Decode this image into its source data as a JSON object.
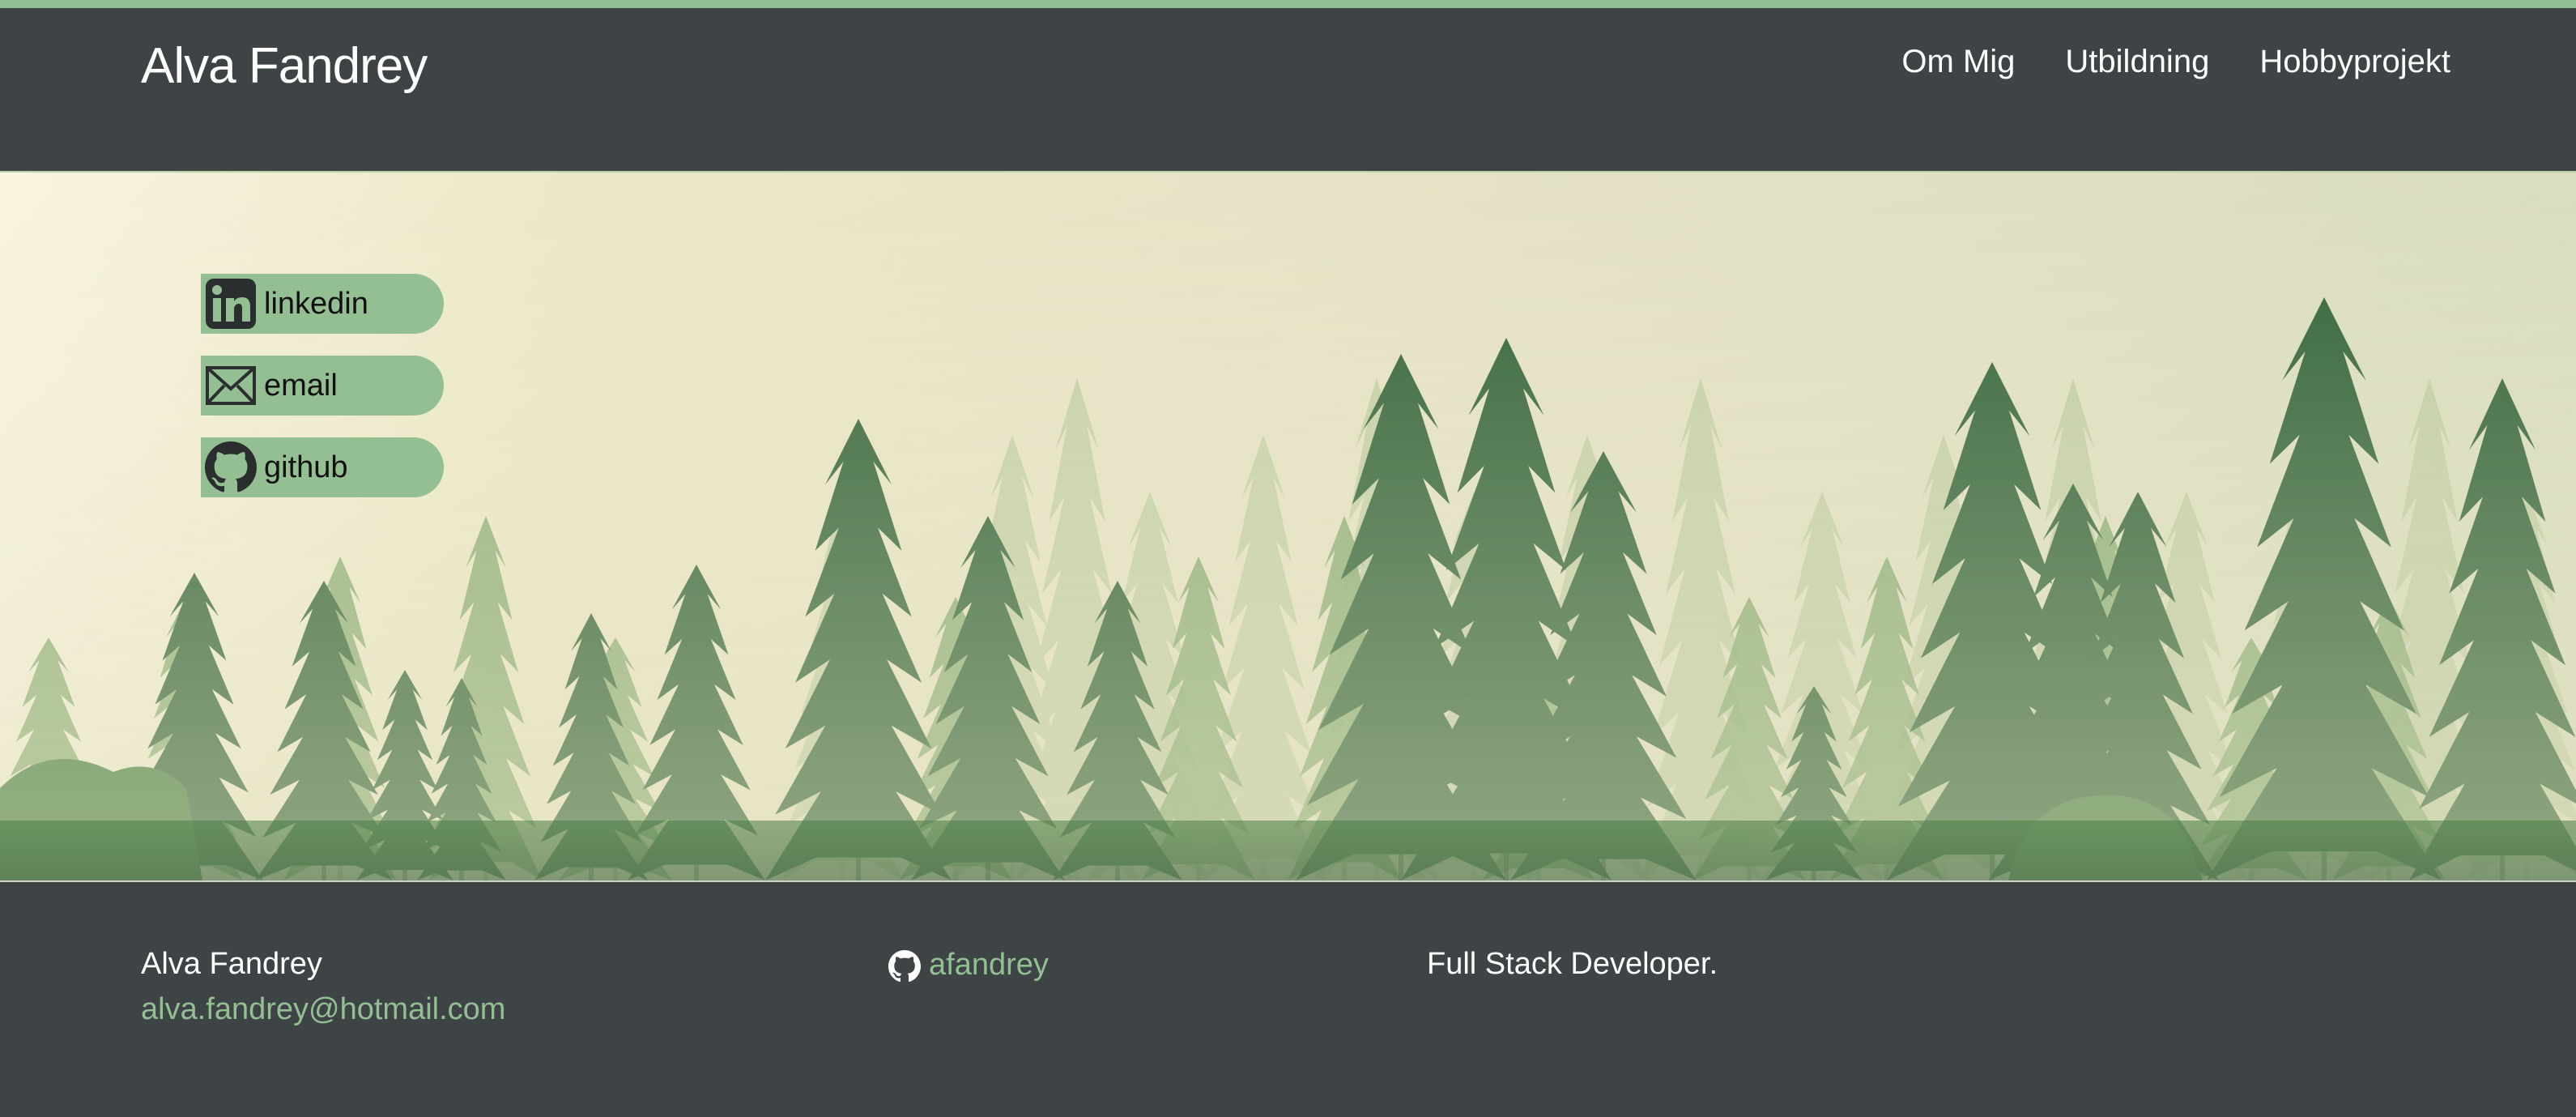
{
  "header": {
    "brand": "Alva Fandrey",
    "nav": [
      "Om Mig",
      "Utbildning",
      "Hobbyprojekt"
    ]
  },
  "social": [
    {
      "label": "linkedin",
      "icon": "linkedin-icon"
    },
    {
      "label": "email",
      "icon": "envelope-icon"
    },
    {
      "label": "github",
      "icon": "github-icon"
    }
  ],
  "footer": {
    "name": "Alva Fandrey",
    "email": "alva.fandrey@hotmail.com",
    "github_handle": "afandrey",
    "github_icon": "github-icon",
    "tagline": "Full Stack Developer."
  },
  "colors": {
    "accent": "#93bf93",
    "dark": "#3e4346",
    "text": "#ffffff",
    "hero_mist": "#ece8c7",
    "tree_dark": "#2d5c37"
  }
}
